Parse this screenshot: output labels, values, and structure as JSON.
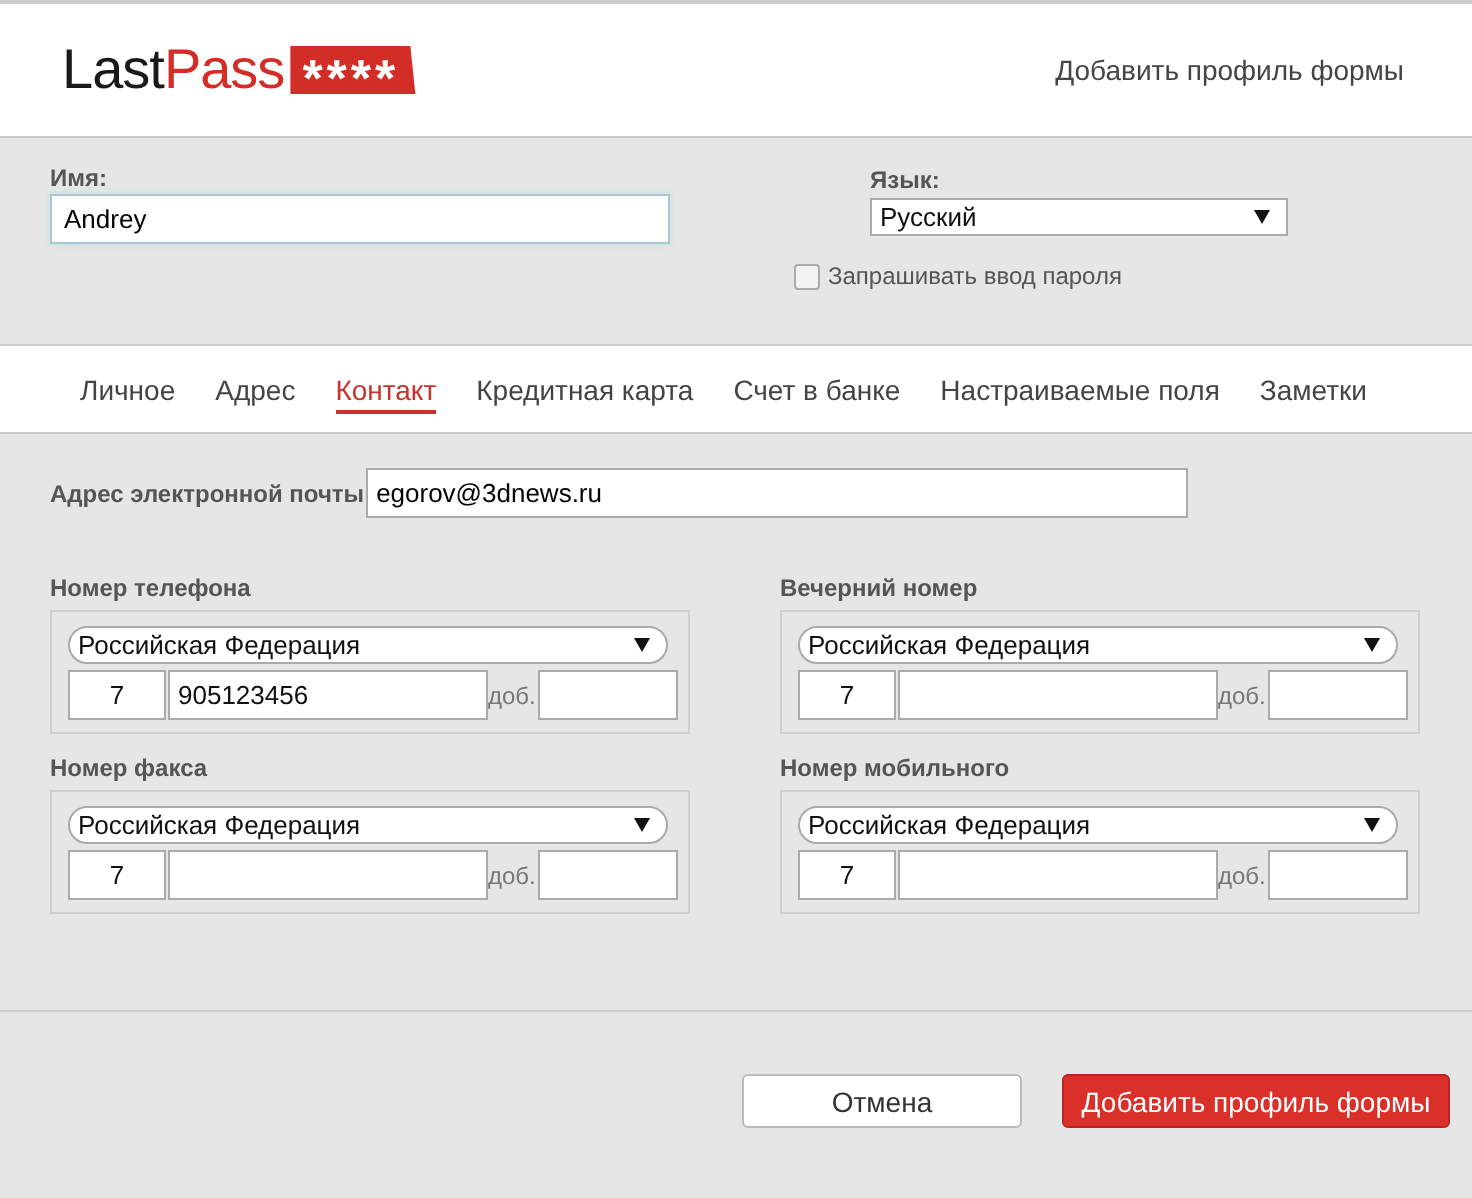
{
  "header": {
    "logo": {
      "dark": "Last",
      "accent": "Pass",
      "badge": "****"
    },
    "title": "Добавить профиль формы"
  },
  "profile": {
    "name_label": "Имя:",
    "name_value": "Andrey",
    "language_label": "Язык:",
    "language_value": "Русский",
    "ask_password": {
      "label": "Запрашивать ввод пароля",
      "checked": false
    }
  },
  "tabs": [
    {
      "label": "Личное",
      "selected": false
    },
    {
      "label": "Адрес",
      "selected": false
    },
    {
      "label": "Контакт",
      "selected": true
    },
    {
      "label": "Кредитная карта",
      "selected": false
    },
    {
      "label": "Счет в банке",
      "selected": false
    },
    {
      "label": "Настраиваемые поля",
      "selected": false
    },
    {
      "label": "Заметки",
      "selected": false
    }
  ],
  "email": {
    "label": "Адрес электронной почты",
    "value": "egorov@3dnews.ru"
  },
  "phones": [
    {
      "label": "Номер телефона",
      "country": "Российская Федерация",
      "code": "7",
      "number": "905123456",
      "ext_label": "доб."
    },
    {
      "label": "Вечерний номер",
      "country": "Российская Федерация",
      "code": "7",
      "ext_label": "доб."
    },
    {
      "label": "Номер факса",
      "country": "Российская Федерация",
      "code": "7",
      "ext_label": "доб."
    },
    {
      "label": "Номер мобильного",
      "country": "Российская Федерация",
      "code": "7",
      "ext_label": "доб."
    }
  ],
  "buttons": {
    "cancel": "Отмена",
    "submit": "Добавить профиль формы"
  }
}
